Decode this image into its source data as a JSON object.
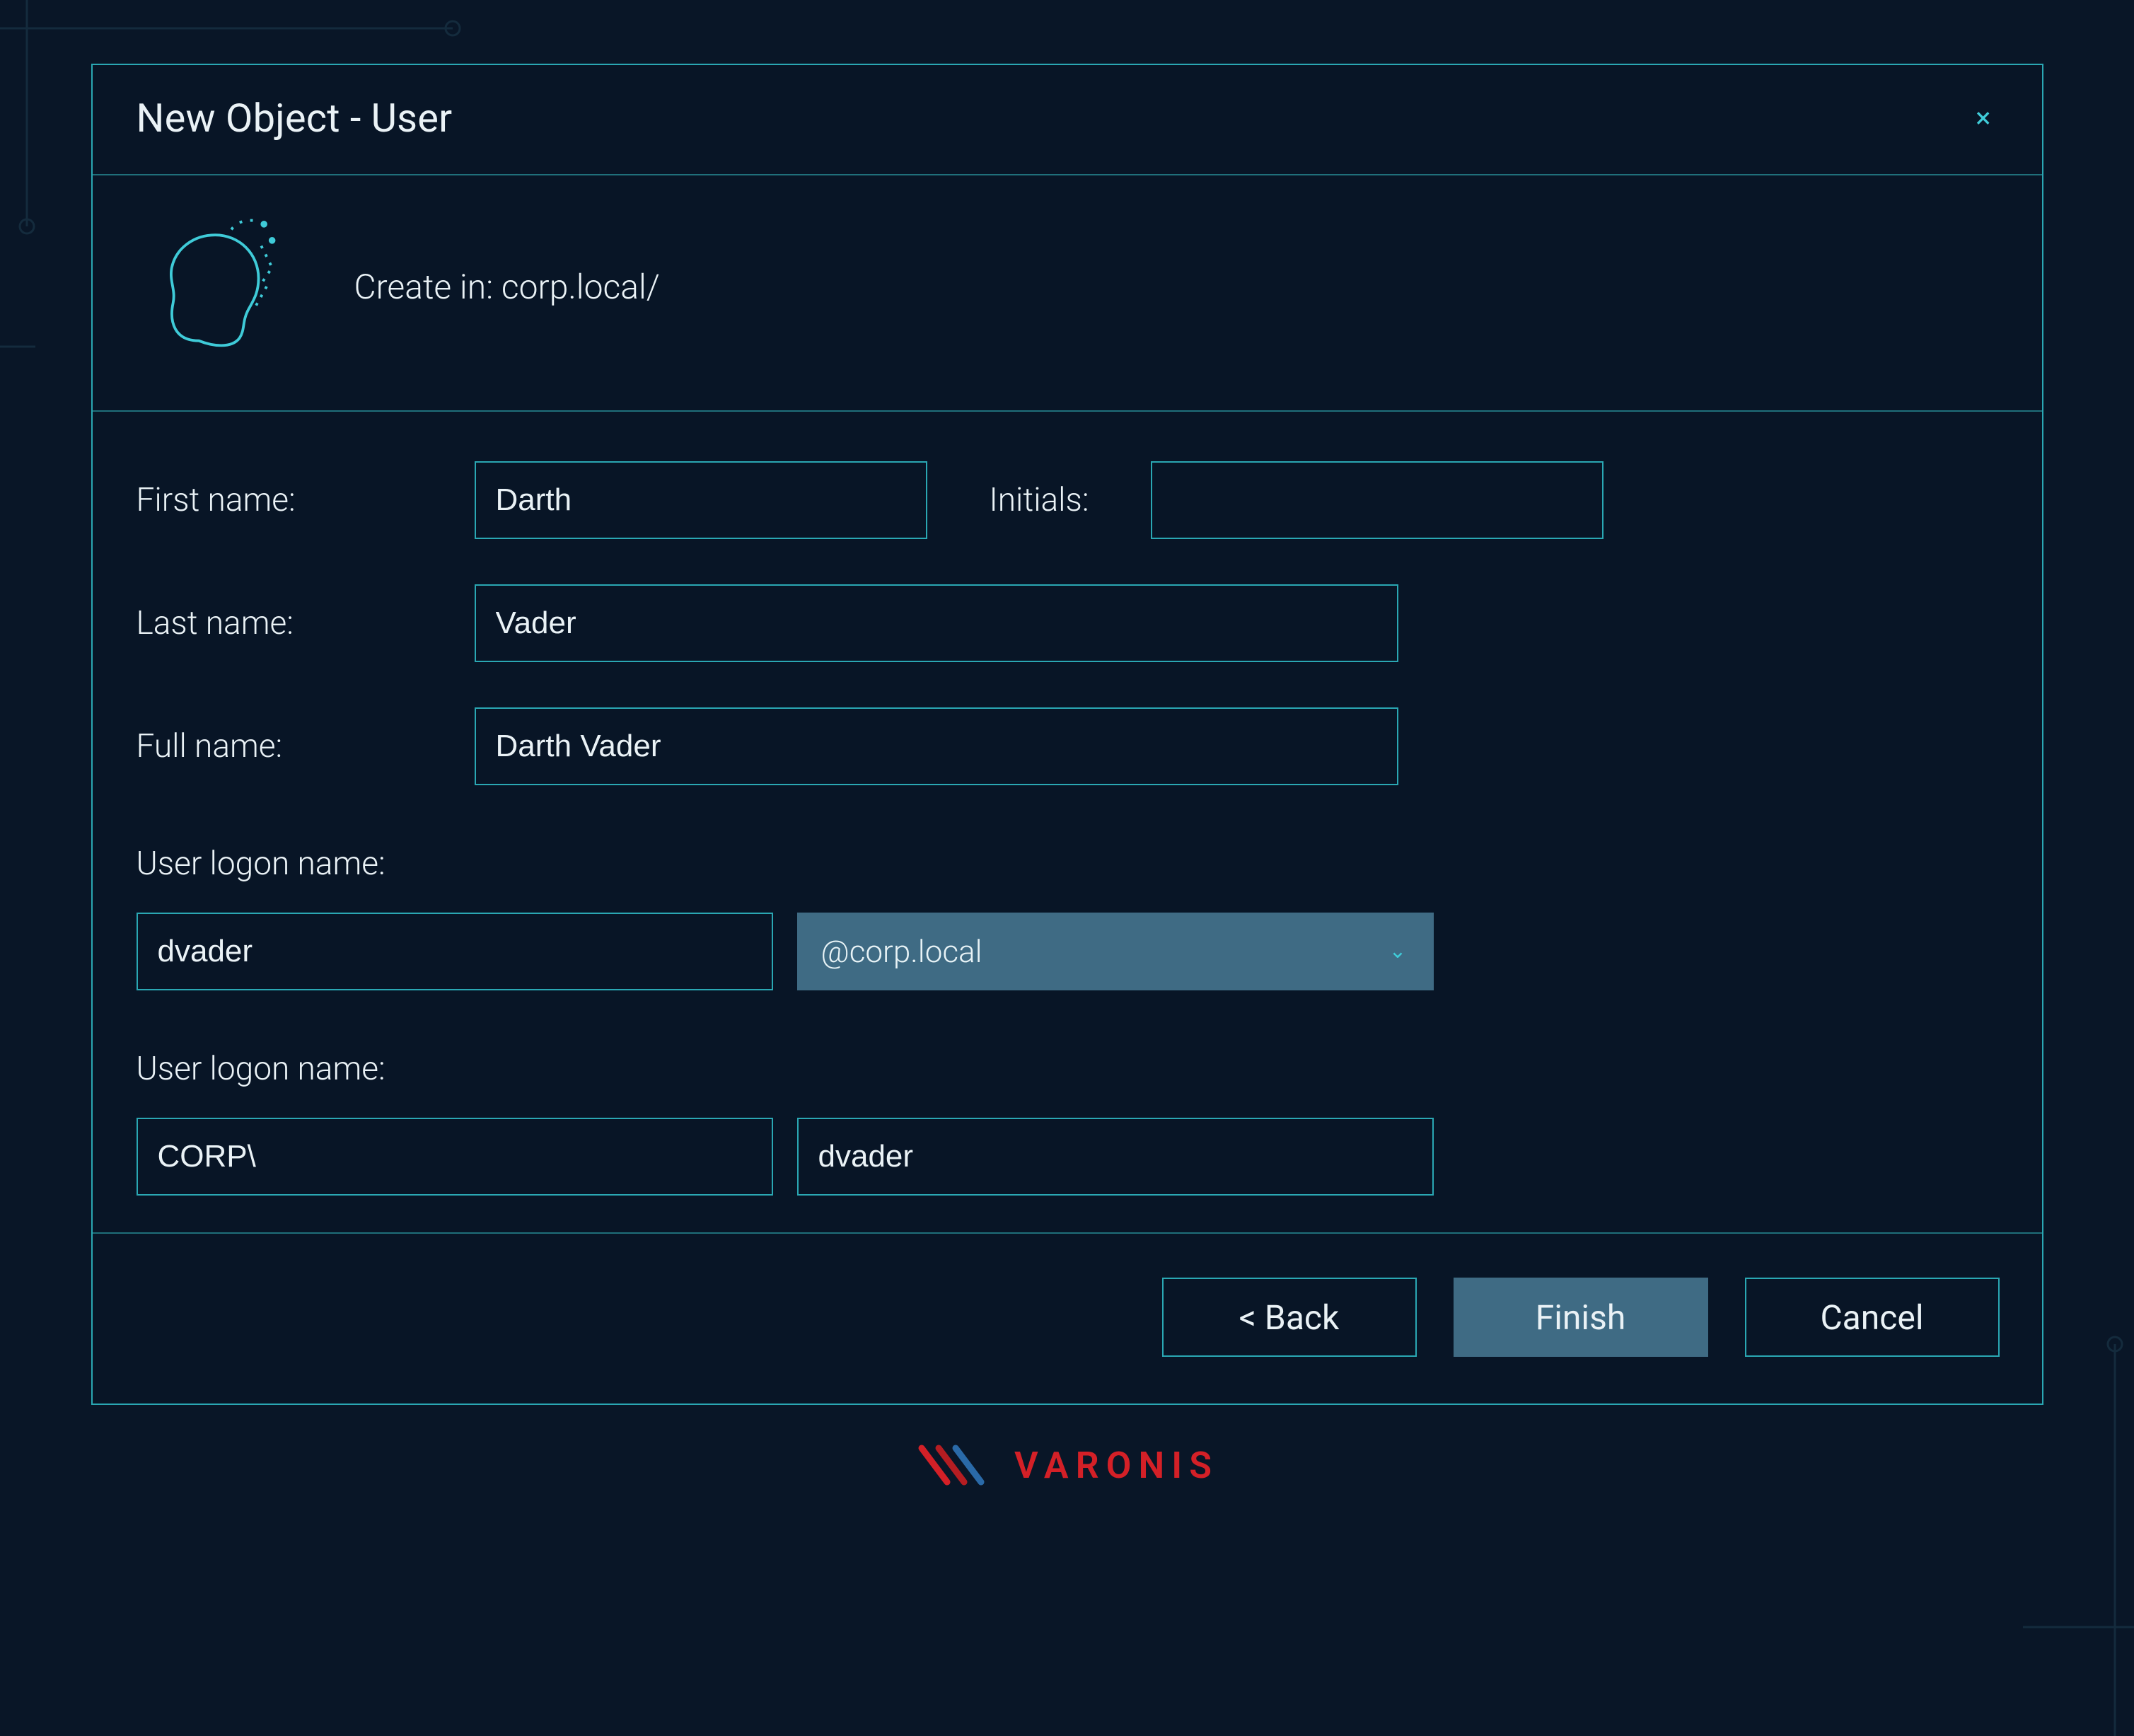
{
  "dialog": {
    "title": "New Object - User",
    "create_in_label": "Create in: corp.local/"
  },
  "form": {
    "first_name": {
      "label": "First name:",
      "value": "Darth"
    },
    "initials": {
      "label": "Initials:",
      "value": ""
    },
    "last_name": {
      "label": "Last name:",
      "value": "Vader"
    },
    "full_name": {
      "label": "Full name:",
      "value": "Darth Vader"
    },
    "upn": {
      "label": "User logon name:",
      "value": "dvader",
      "domain_selected": "@corp.local"
    },
    "nt_logon": {
      "label": "User logon name:",
      "domain": "CORP\\",
      "value": "dvader"
    }
  },
  "buttons": {
    "back": "< Back",
    "finish": "Finish",
    "cancel": "Cancel"
  },
  "brand": {
    "name": "VARONIS"
  },
  "icons": {
    "close": "×",
    "chevron_down": "⌄"
  }
}
